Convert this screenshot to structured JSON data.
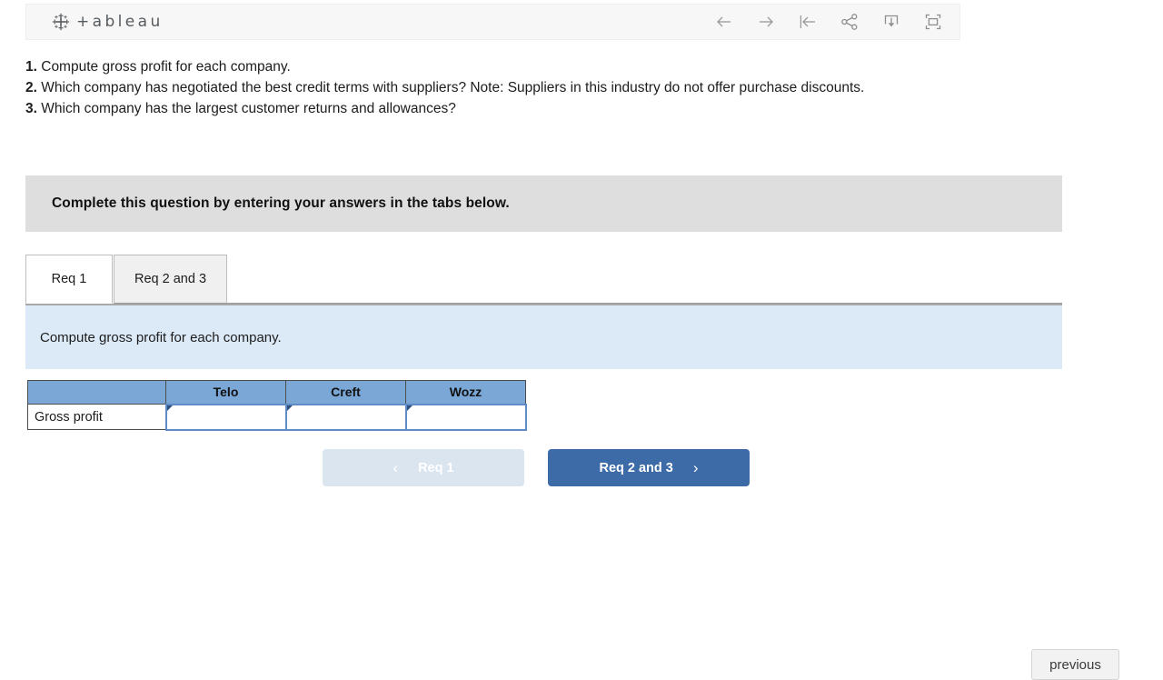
{
  "toolbar": {
    "brand_word": "+ableau",
    "brand_icon": "tableau-logo-icon",
    "buttons": [
      {
        "name": "back-button",
        "icon": "arrow-left-icon",
        "label": ""
      },
      {
        "name": "forward-button",
        "icon": "arrow-right-icon",
        "label": ""
      },
      {
        "name": "revert-button",
        "icon": "revert-to-start-icon",
        "label": ""
      },
      {
        "name": "share-button",
        "icon": "share-icon",
        "label": ""
      },
      {
        "name": "download-button",
        "icon": "download-icon",
        "label": ""
      },
      {
        "name": "fullscreen-button",
        "icon": "fullscreen-icon",
        "label": ""
      }
    ]
  },
  "stem": {
    "item1_num": "1.",
    "item1_text": " Compute gross profit for each company.",
    "item2_num": "2.",
    "item2_text": " Which company has negotiated the best credit terms with suppliers? Note: Suppliers in this industry do not offer purchase discounts.",
    "item3_num": "3.",
    "item3_text": " Which company has the largest customer returns and allowances?"
  },
  "banner": {
    "text": "Complete this question by entering your answers in the tabs below."
  },
  "tabs": [
    {
      "label": "Req 1",
      "active": true
    },
    {
      "label": "Req 2 and 3",
      "active": false
    }
  ],
  "requirement": {
    "text": "Compute gross profit for each company."
  },
  "answer_table": {
    "columns": [
      "",
      "Telo",
      "Creft",
      "Wozz"
    ],
    "rows": [
      {
        "label": "Gross profit",
        "values": [
          "",
          "",
          ""
        ],
        "placeholders": [
          "",
          "",
          ""
        ]
      }
    ]
  },
  "nav": {
    "prev_label": "Req 1",
    "prev_chevron": "‹",
    "prev_disabled": true,
    "next_label": "Req 2 and 3",
    "next_chevron": "›"
  },
  "bottom": {
    "previous_label": "previous"
  },
  "colors": {
    "banner_gray": "#dedede",
    "panel_blue": "#dce9f7",
    "table_header_blue": "#7ba7d7",
    "entry_border_blue": "#5f8cc4",
    "next_button_blue": "#3d6ba8",
    "prev_button_disabled": "#dbe5f0",
    "toolbar_bg": "#f7f7f7"
  }
}
